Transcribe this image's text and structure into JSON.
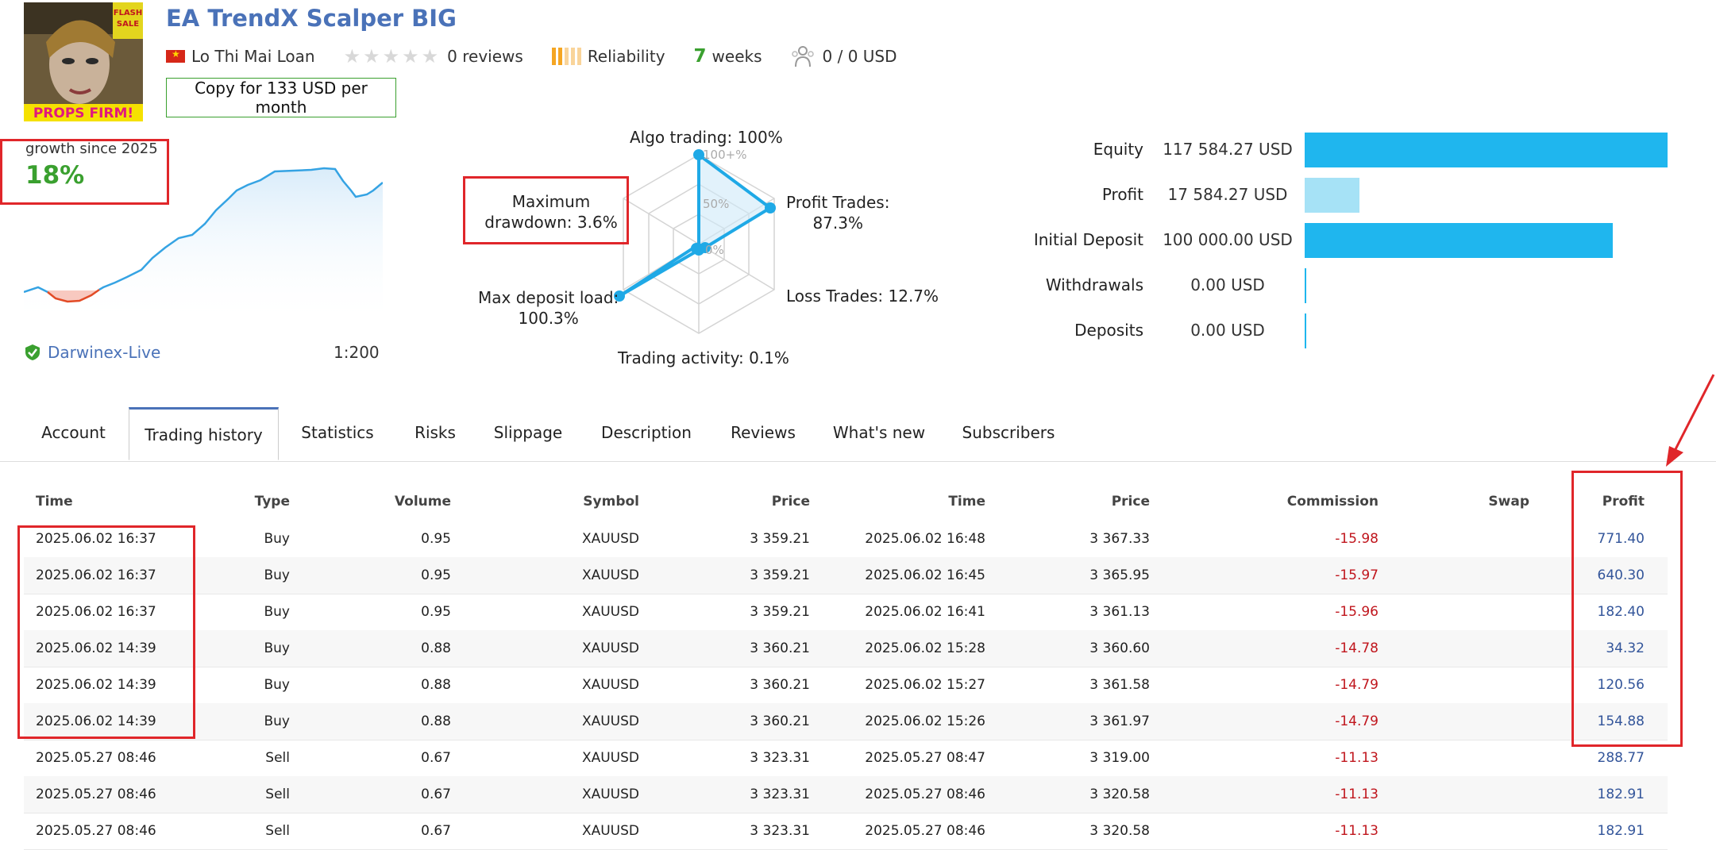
{
  "product": {
    "title": "EA TrendX Scalper BIG",
    "author": "Lo Thi Mai Loan",
    "reviews": "0 reviews",
    "reliability": "Reliability",
    "weeks_num": "7",
    "weeks_label": "weeks",
    "subscribers": "0 / 0 USD",
    "copy_button": "Copy for 133 USD per month",
    "logo_badge": "FLASH SALE",
    "logo_text": "PROPS FIRM!"
  },
  "growth": {
    "label": "growth since 2025",
    "value": "18%",
    "broker": "Darwinex-Live",
    "leverage": "1:200"
  },
  "radar": {
    "algo": "Algo trading: 100%",
    "profit_trades_1": "Profit Trades:",
    "profit_trades_2": "87.3%",
    "loss_trades": "Loss Trades: 12.7%",
    "activity": "Trading activity: 0.1%",
    "deposit_load_1": "Max deposit load:",
    "deposit_load_2": "100.3%",
    "drawdown_1": "Maximum",
    "drawdown_2": "drawdown: 3.6%",
    "axis_100": "100+%",
    "axis_50": "50%",
    "axis_0": "0%"
  },
  "balance": [
    {
      "label": "Equity",
      "value": "117 584.27 USD",
      "fraction": 1.0,
      "color": "#1fb6ee"
    },
    {
      "label": "Profit",
      "value": "17 584.27 USD",
      "fraction": 0.15,
      "color": "#a6e2f6"
    },
    {
      "label": "Initial Deposit",
      "value": "100 000.00 USD",
      "fraction": 0.85,
      "color": "#1fb6ee"
    },
    {
      "label": "Withdrawals",
      "value": "0.00 USD",
      "fraction": 0.003,
      "color": "#1fb6ee"
    },
    {
      "label": "Deposits",
      "value": "0.00 USD",
      "fraction": 0.003,
      "color": "#1fb6ee"
    }
  ],
  "tabs": [
    "Account",
    "Trading history",
    "Statistics",
    "Risks",
    "Slippage",
    "Description",
    "Reviews",
    "What's new",
    "Subscribers"
  ],
  "table": {
    "headers": [
      "Time",
      "Type",
      "Volume",
      "Symbol",
      "Price",
      "Time",
      "Price",
      "Commission",
      "Swap",
      "Profit"
    ],
    "rows": [
      [
        "2025.06.02 16:37",
        "Buy",
        "0.95",
        "XAUUSD",
        "3 359.21",
        "2025.06.02 16:48",
        "3 367.33",
        "-15.98",
        "",
        "771.40"
      ],
      [
        "2025.06.02 16:37",
        "Buy",
        "0.95",
        "XAUUSD",
        "3 359.21",
        "2025.06.02 16:45",
        "3 365.95",
        "-15.97",
        "",
        "640.30"
      ],
      [
        "2025.06.02 16:37",
        "Buy",
        "0.95",
        "XAUUSD",
        "3 359.21",
        "2025.06.02 16:41",
        "3 361.13",
        "-15.96",
        "",
        "182.40"
      ],
      [
        "2025.06.02 14:39",
        "Buy",
        "0.88",
        "XAUUSD",
        "3 360.21",
        "2025.06.02 15:28",
        "3 360.60",
        "-14.78",
        "",
        "34.32"
      ],
      [
        "2025.06.02 14:39",
        "Buy",
        "0.88",
        "XAUUSD",
        "3 360.21",
        "2025.06.02 15:27",
        "3 361.58",
        "-14.79",
        "",
        "120.56"
      ],
      [
        "2025.06.02 14:39",
        "Buy",
        "0.88",
        "XAUUSD",
        "3 360.21",
        "2025.06.02 15:26",
        "3 361.97",
        "-14.79",
        "",
        "154.88"
      ],
      [
        "2025.05.27 08:46",
        "Sell",
        "0.67",
        "XAUUSD",
        "3 323.31",
        "2025.05.27 08:47",
        "3 319.00",
        "-11.13",
        "",
        "288.77"
      ],
      [
        "2025.05.27 08:46",
        "Sell",
        "0.67",
        "XAUUSD",
        "3 323.31",
        "2025.05.27 08:46",
        "3 320.58",
        "-11.13",
        "",
        "182.91"
      ],
      [
        "2025.05.27 08:46",
        "Sell",
        "0.67",
        "XAUUSD",
        "3 323.31",
        "2025.05.27 08:46",
        "3 320.58",
        "-11.13",
        "",
        "182.91"
      ]
    ]
  },
  "colors": {
    "link": "#4a72b8",
    "green": "#3aa02f",
    "negative": "#c0161d",
    "positive": "#33559a",
    "annotation": "#e0262a",
    "bar": "#1fb6ee"
  }
}
